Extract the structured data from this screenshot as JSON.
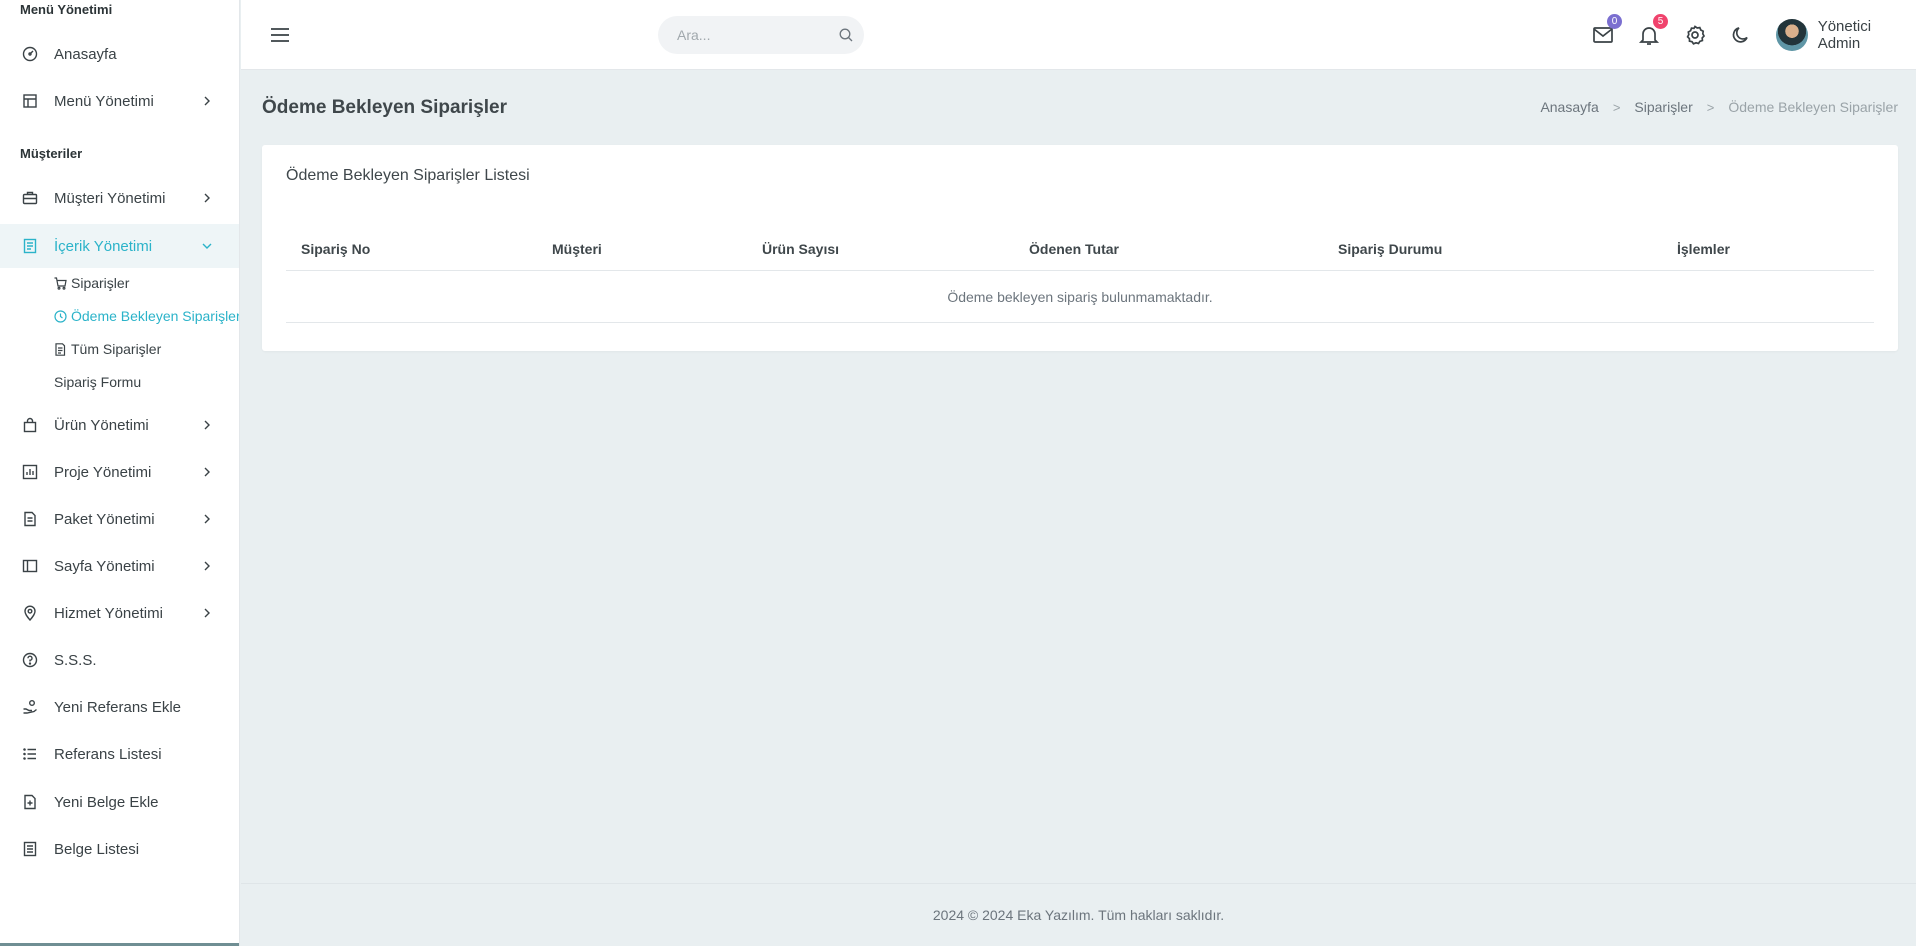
{
  "sidebar": {
    "section_menu": "Menü Yönetimi",
    "section_customers": "Müşteriler",
    "items": {
      "home": "Anasayfa",
      "menu_management": "Menü Yönetimi",
      "customer_management": "Müşteri Yönetimi",
      "content_management": "İçerik Yönetimi",
      "product_management": "Ürün Yönetimi",
      "project_management": "Proje Yönetimi",
      "package_management": "Paket Yönetimi",
      "page_management": "Sayfa Yönetimi",
      "service_management": "Hizmet Yönetimi",
      "faq": "S.S.S.",
      "new_reference": "Yeni Referans Ekle",
      "reference_list": "Referans Listesi",
      "new_document": "Yeni Belge Ekle",
      "document_list": "Belge Listesi"
    },
    "sub_items": {
      "orders": "Siparişler",
      "pending_payment_orders": "Ödeme Bekleyen Siparişler",
      "all_orders": "Tüm Siparişler",
      "order_form": "Sipariş Formu"
    }
  },
  "topbar": {
    "search_placeholder": "Ara...",
    "mail_count": "0",
    "notification_count": "5",
    "user_name": "Yönetici Admin"
  },
  "page": {
    "title": "Ödeme Bekleyen Siparişler",
    "breadcrumb": [
      "Anasayfa",
      "Siparişler",
      "Ödeme Bekleyen Siparişler"
    ]
  },
  "card": {
    "title": "Ödeme Bekleyen Siparişler Listesi",
    "columns": [
      "Sipariş No",
      "Müşteri",
      "Ürün Sayısı",
      "Ödenen Tutar",
      "Sipariş Durumu",
      "İşlemler"
    ],
    "empty_message": "Ödeme bekleyen sipariş bulunmamaktadır."
  },
  "footer": {
    "text": "2024 © 2024 Eka Yazılım. Tüm hakları saklıdır."
  },
  "colors": {
    "accent": "#2bb3c9",
    "background": "#e9eff1",
    "mail_badge": "#7b6fd0",
    "notification_badge": "#f0436d"
  }
}
